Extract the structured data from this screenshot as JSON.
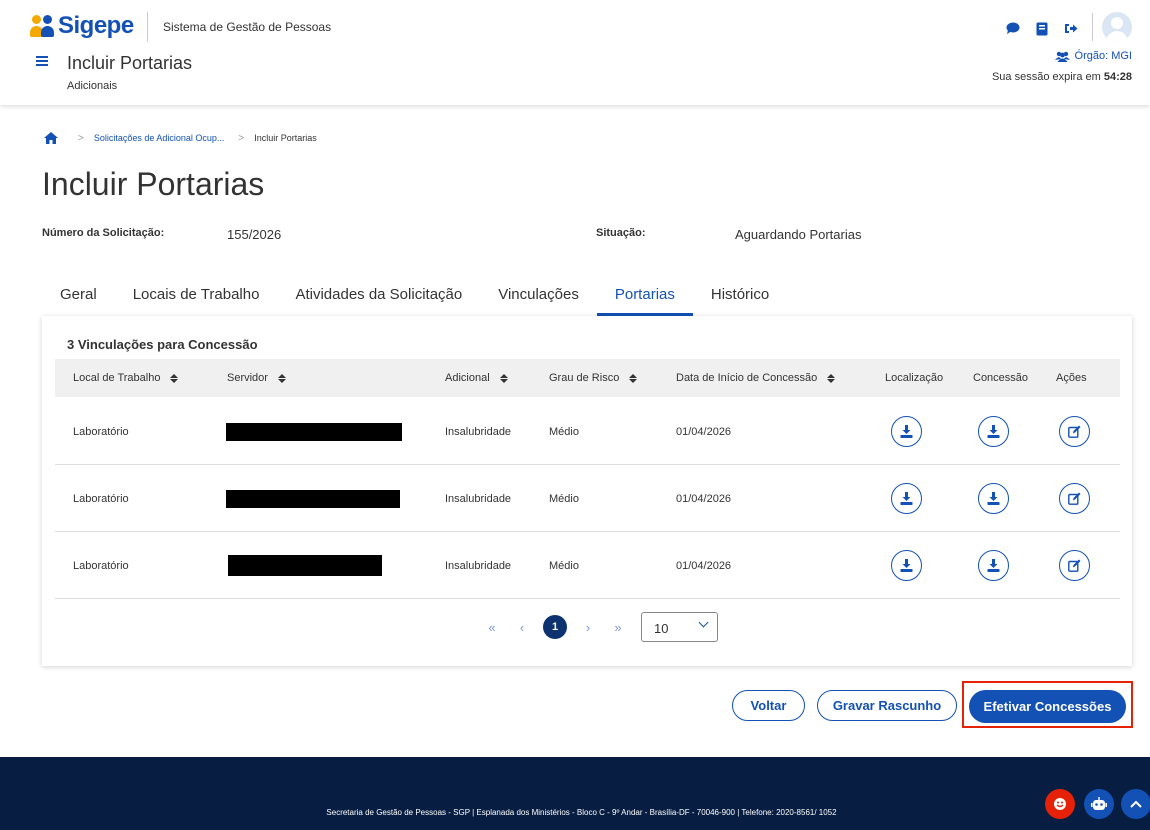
{
  "header": {
    "logo_text": "Sigepe",
    "system_name": "Sistema de Gestão de Pessoas",
    "title": "Incluir Portarias",
    "subtitle": "Adicionais",
    "orgao": "Órgão: MGI",
    "session_prefix": "Sua sessão expira em",
    "session_time": "54:28"
  },
  "breadcrumb": {
    "items": [
      "Solicitações de Adicional Ocup...",
      "Incluir Portarias"
    ]
  },
  "page": {
    "title": "Incluir Portarias",
    "numero_label": "Número da Solicitação:",
    "numero_value": "155/2026",
    "situacao_label": "Situação:",
    "situacao_value": "Aguardando Portarias"
  },
  "tabs": [
    "Geral",
    "Locais de Trabalho",
    "Atividades da Solicitação",
    "Vinculações",
    "Portarias",
    "Histórico"
  ],
  "active_tab": "Portarias",
  "table": {
    "title": "3 Vinculações para Concessão",
    "columns": [
      "Local de Trabalho",
      "Servidor",
      "Adicional",
      "Grau de Risco",
      "Data de Início de Concessão",
      "Localização",
      "Concessão",
      "Ações"
    ],
    "rows": [
      {
        "local": "Laboratório",
        "servidor": "",
        "adicional": "Insalubridade",
        "grau": "Médio",
        "data": "01/04/2026"
      },
      {
        "local": "Laboratório",
        "servidor": "",
        "adicional": "Insalubridade",
        "grau": "Médio",
        "data": "01/04/2026"
      },
      {
        "local": "Laboratório",
        "servidor": "",
        "adicional": "Insalubridade",
        "grau": "Médio",
        "data": "01/04/2026"
      }
    ]
  },
  "pagination": {
    "first": "«",
    "prev": "‹",
    "current": "1",
    "next": "›",
    "last": "»",
    "page_size": "10"
  },
  "buttons": {
    "voltar": "Voltar",
    "gravar": "Gravar Rascunho",
    "efetivar": "Efetivar Concessões"
  },
  "footer": {
    "text": "Secretaria de Gestão de Pessoas - SGP | Esplanada dos Ministérios - Bloco C - 9º Andar - Brasília-DF - 70046-900 | Telefone: 2020-8561/ 1052"
  },
  "colors": {
    "primary": "#1351b4",
    "dark_blue": "#071d41",
    "highlight": "#e52207",
    "accent_yellow": "#f5a800"
  }
}
